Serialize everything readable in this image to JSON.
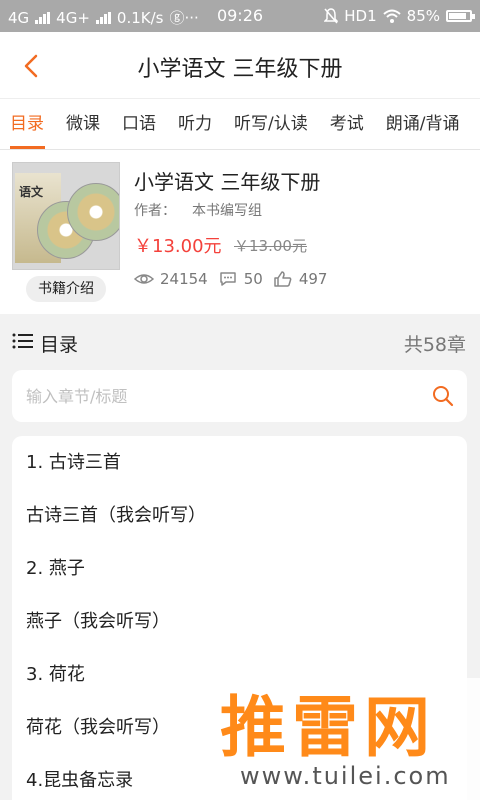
{
  "status_bar": {
    "net1": "4G",
    "net2": "4G+",
    "speed": "0.1K/s",
    "extra": "ⓖ···",
    "time": "09:26",
    "hd": "HD1",
    "battery": "85%",
    "battery_level": 0.85
  },
  "header": {
    "title": "小学语文  三年级下册",
    "back_icon": "arrow-left-icon",
    "accent_color": "#f26b21"
  },
  "tabs": [
    "目录",
    "微课",
    "口语",
    "听力",
    "听写/认读",
    "考试",
    "朗诵/背诵"
  ],
  "book": {
    "title": "小学语文  三年级下册",
    "cover_text": "语文",
    "author_label": "作者：",
    "author": "本书编写组",
    "price": "￥13.00元",
    "old_price": "￥13.00元",
    "intro_button": "书籍介绍",
    "views": "24154",
    "comments": "50",
    "likes": "497",
    "price_color": "#f4413b"
  },
  "catalog": {
    "label": "目录",
    "count": "共58章",
    "search_placeholder": "输入章节/标题",
    "chapters": [
      "1. 古诗三首",
      "古诗三首（我会听写）",
      "2. 燕子",
      "燕子（我会听写）",
      "3. 荷花",
      "荷花（我会听写）",
      "4.昆虫备忘录"
    ]
  },
  "watermark": {
    "brand": "推雷网",
    "url": "www.tuilei.com"
  }
}
